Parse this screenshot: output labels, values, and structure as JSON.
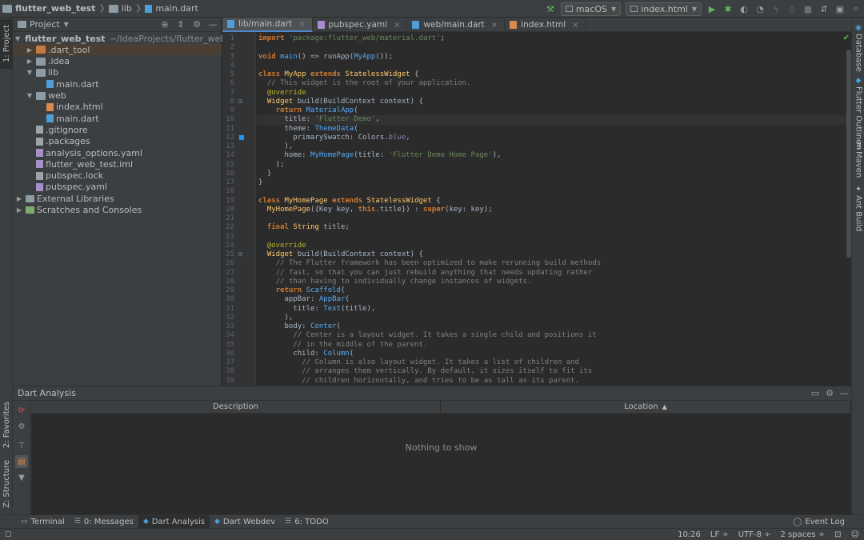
{
  "navbar": {
    "crumbs": [
      "flutter_web_test",
      "lib",
      "main.dart"
    ]
  },
  "toolbar": {
    "device": "macOS",
    "target": "index.html"
  },
  "left_stripe": {
    "project": "1: Project",
    "favorites": "2: Favorites",
    "structure": "Z: Structure"
  },
  "right_stripe": {
    "database": "Database",
    "flutter_outline": "Flutter Outline",
    "maven": "Maven",
    "ant": "Ant Build"
  },
  "project_panel": {
    "title": "Project",
    "tree": [
      {
        "name": "flutter_web_test",
        "path": "~/IdeaProjects/flutter_web_test",
        "depth": 0,
        "arrow": "▼",
        "icon": "folder-blue",
        "bold": true
      },
      {
        "name": ".dart_tool",
        "depth": 1,
        "arrow": "▶",
        "icon": "folder-orange",
        "selected": true
      },
      {
        "name": ".idea",
        "depth": 1,
        "arrow": "▶",
        "icon": "folder"
      },
      {
        "name": "lib",
        "depth": 1,
        "arrow": "▼",
        "icon": "folder"
      },
      {
        "name": "main.dart",
        "depth": 2,
        "arrow": "",
        "icon": "file-dart"
      },
      {
        "name": "web",
        "depth": 1,
        "arrow": "▼",
        "icon": "folder"
      },
      {
        "name": "index.html",
        "depth": 2,
        "arrow": "",
        "icon": "file-html"
      },
      {
        "name": "main.dart",
        "depth": 2,
        "arrow": "",
        "icon": "file-dart"
      },
      {
        "name": ".gitignore",
        "depth": 1,
        "arrow": "",
        "icon": "file-gen"
      },
      {
        "name": ".packages",
        "depth": 1,
        "arrow": "",
        "icon": "file-gen"
      },
      {
        "name": "analysis_options.yaml",
        "depth": 1,
        "arrow": "",
        "icon": "file-iml"
      },
      {
        "name": "flutter_web_test.iml",
        "depth": 1,
        "arrow": "",
        "icon": "file-iml"
      },
      {
        "name": "pubspec.lock",
        "depth": 1,
        "arrow": "",
        "icon": "file-gen"
      },
      {
        "name": "pubspec.yaml",
        "depth": 1,
        "arrow": "",
        "icon": "file-iml"
      },
      {
        "name": "External Libraries",
        "depth": 0,
        "arrow": "▶",
        "icon": "lib"
      },
      {
        "name": "Scratches and Consoles",
        "depth": 0,
        "arrow": "▶",
        "icon": "scratch"
      }
    ]
  },
  "editor": {
    "tabs": [
      {
        "label": "lib/main.dart",
        "active": true,
        "icon": "file-dart"
      },
      {
        "label": "pubspec.yaml",
        "active": false,
        "icon": "file-iml"
      },
      {
        "label": "web/main.dart",
        "active": false,
        "icon": "file-dart"
      },
      {
        "label": "index.html",
        "active": false,
        "icon": "file-html"
      }
    ],
    "current_line": 10,
    "lines": [
      [
        [
          "kw",
          "import "
        ],
        [
          "str",
          "'package:flutter_web/material.dart'"
        ],
        [
          "plain",
          ";"
        ]
      ],
      [],
      [
        [
          "kw",
          "void "
        ],
        [
          "call",
          "main"
        ],
        [
          "plain",
          "() => runApp("
        ],
        [
          "call",
          "MyApp"
        ],
        [
          "plain",
          "());"
        ]
      ],
      [],
      [
        [
          "kw",
          "class "
        ],
        [
          "cls",
          "MyApp "
        ],
        [
          "kw",
          "extends "
        ],
        [
          "cls",
          "StatelessWidget "
        ],
        [
          "plain",
          "{"
        ]
      ],
      [
        [
          "plain",
          "  "
        ],
        [
          "cmt",
          "// This widget is the root of your application."
        ]
      ],
      [
        [
          "plain",
          "  "
        ],
        [
          "ann",
          "@override"
        ]
      ],
      [
        [
          "plain",
          "  "
        ],
        [
          "cls",
          "Widget "
        ],
        [
          "plain",
          "build(BuildContext context) {"
        ]
      ],
      [
        [
          "plain",
          "    "
        ],
        [
          "kw",
          "return "
        ],
        [
          "call",
          "MaterialApp"
        ],
        [
          "plain",
          "("
        ]
      ],
      [
        [
          "plain",
          "      title: "
        ],
        [
          "str",
          "'Flutter Demo'"
        ],
        [
          "plain",
          ","
        ]
      ],
      [
        [
          "plain",
          "      theme: "
        ],
        [
          "call",
          "ThemeData"
        ],
        [
          "plain",
          "("
        ]
      ],
      [
        [
          "plain",
          "        primarySwatch: Colors."
        ],
        [
          "fld",
          "blue"
        ],
        [
          "plain",
          ","
        ]
      ],
      [
        [
          "plain",
          "      ),"
        ]
      ],
      [
        [
          "plain",
          "      home: "
        ],
        [
          "call",
          "MyHomePage"
        ],
        [
          "plain",
          "(title: "
        ],
        [
          "str",
          "'Flutter Demo Home Page'"
        ],
        [
          "plain",
          "),"
        ]
      ],
      [
        [
          "plain",
          "    );"
        ]
      ],
      [
        [
          "plain",
          "  }"
        ]
      ],
      [
        [
          "plain",
          "}"
        ]
      ],
      [],
      [
        [
          "kw",
          "class "
        ],
        [
          "cls",
          "MyHomePage "
        ],
        [
          "kw",
          "extends "
        ],
        [
          "cls",
          "StatelessWidget "
        ],
        [
          "plain",
          "{"
        ]
      ],
      [
        [
          "plain",
          "  "
        ],
        [
          "cls",
          "MyHomePage"
        ],
        [
          "plain",
          "({Key key, "
        ],
        [
          "kw",
          "this"
        ],
        [
          "plain",
          ".title}) : "
        ],
        [
          "kw",
          "super"
        ],
        [
          "plain",
          "(key: key);"
        ]
      ],
      [],
      [
        [
          "plain",
          "  "
        ],
        [
          "kw",
          "final "
        ],
        [
          "cls",
          "String "
        ],
        [
          "plain",
          "title;"
        ]
      ],
      [],
      [
        [
          "plain",
          "  "
        ],
        [
          "ann",
          "@override"
        ]
      ],
      [
        [
          "plain",
          "  "
        ],
        [
          "cls",
          "Widget "
        ],
        [
          "plain",
          "build(BuildContext context) {"
        ]
      ],
      [
        [
          "plain",
          "    "
        ],
        [
          "cmt",
          "// The Flutter framework has been optimized to make rerunning build methods"
        ]
      ],
      [
        [
          "plain",
          "    "
        ],
        [
          "cmt",
          "// fast, so that you can just rebuild anything that needs updating rather"
        ]
      ],
      [
        [
          "plain",
          "    "
        ],
        [
          "cmt",
          "// than having to individually change instances of widgets."
        ]
      ],
      [
        [
          "plain",
          "    "
        ],
        [
          "kw",
          "return "
        ],
        [
          "call",
          "Scaffold"
        ],
        [
          "plain",
          "("
        ]
      ],
      [
        [
          "plain",
          "      appBar: "
        ],
        [
          "call",
          "AppBar"
        ],
        [
          "plain",
          "("
        ]
      ],
      [
        [
          "plain",
          "        title: "
        ],
        [
          "call",
          "Text"
        ],
        [
          "plain",
          "(title),"
        ]
      ],
      [
        [
          "plain",
          "      ),"
        ]
      ],
      [
        [
          "plain",
          "      body: "
        ],
        [
          "call",
          "Center"
        ],
        [
          "plain",
          "("
        ]
      ],
      [
        [
          "plain",
          "        "
        ],
        [
          "cmt",
          "// Center is a layout widget. It takes a single child and positions it"
        ]
      ],
      [
        [
          "plain",
          "        "
        ],
        [
          "cmt",
          "// in the middle of the parent."
        ]
      ],
      [
        [
          "plain",
          "        child: "
        ],
        [
          "call",
          "Column"
        ],
        [
          "plain",
          "("
        ]
      ],
      [
        [
          "plain",
          "          "
        ],
        [
          "cmt",
          "// Column is also layout widget. It takes a list of children and"
        ]
      ],
      [
        [
          "plain",
          "          "
        ],
        [
          "cmt",
          "// arranges them vertically. By default, it sizes itself to fit its"
        ]
      ],
      [
        [
          "plain",
          "          "
        ],
        [
          "cmt",
          "// children horizontally, and tries to be as tall as its parent."
        ]
      ]
    ]
  },
  "analysis": {
    "title": "Dart Analysis",
    "col_description": "Description",
    "col_location": "Location",
    "sort_arrow": "▲",
    "empty": "Nothing to show"
  },
  "toolwindows": {
    "terminal": "Terminal",
    "messages": "0: Messages",
    "dart_analysis": "Dart Analysis",
    "dart_webdev": "Dart Webdev",
    "todo": "6: TODO",
    "event_log": "Event Log"
  },
  "status": {
    "position": "10:26",
    "line_sep": "LF ÷",
    "encoding": "UTF-8 ÷",
    "indent": "2 spaces ÷"
  },
  "colors": {
    "accent": "#4a88c7",
    "selection": "#4b3e32",
    "run": "#5fb35f"
  }
}
